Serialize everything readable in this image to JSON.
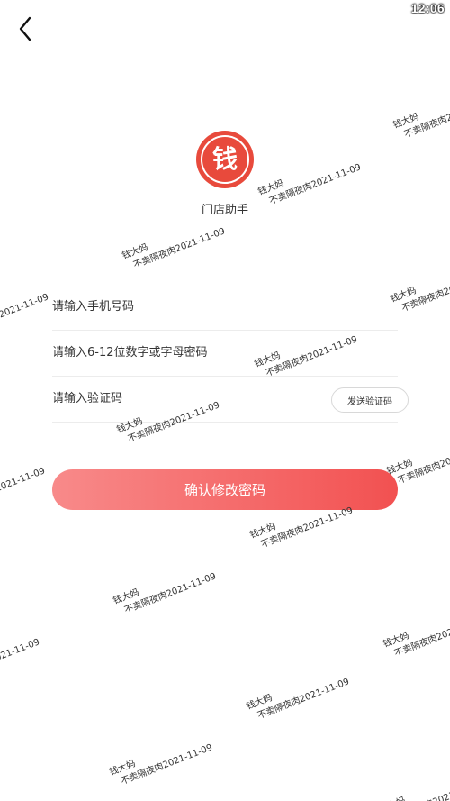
{
  "status_bar": {
    "time": "12:06"
  },
  "header": {
    "back_icon": "chevron-left-icon"
  },
  "app": {
    "logo_char": "钱",
    "logo_color": "#e84a3c",
    "name": "门店助手"
  },
  "form": {
    "phone_placeholder": "请输入手机号码",
    "password_placeholder": "请输入6-12位数字或字母密码",
    "code_placeholder": "请输入验证码",
    "send_code_label": "发送验证码",
    "submit_label": "确认修改密码"
  },
  "watermark": {
    "line1": "钱大妈",
    "line2": "不卖隔夜肉2021-11-09"
  },
  "colors": {
    "accent_start": "#f88a8a",
    "accent_end": "#f25151"
  }
}
